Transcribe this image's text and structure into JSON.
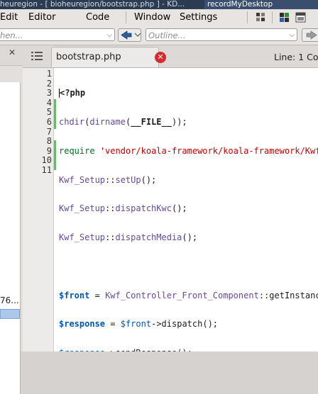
{
  "window": {
    "title_left": "heuregion - [ bioheuregion/bootstrap.php ] - KD...",
    "title_right": "recordMyDesktop"
  },
  "menubar": {
    "items": [
      "Edit",
      "Editor",
      "Code",
      "Window",
      "Settings"
    ]
  },
  "toolbar": {
    "search_value": "hen...",
    "outline_placeholder": "Outline..."
  },
  "left_panel": {
    "close_glyph": "✕",
    "truncated_item": "76..."
  },
  "tab": {
    "label": "bootstrap.php",
    "close_glyph": "✕"
  },
  "status": {
    "line_info": "Line: 1 Co"
  },
  "editor": {
    "line_numbers": [
      "1",
      "2",
      "3",
      "4",
      "5",
      "6",
      "7",
      "8",
      "9",
      "10",
      "11"
    ]
  },
  "colors": {
    "titlebar": "#2b3b52",
    "tab_close": "#d72a2a",
    "string": "#bf0303",
    "function": "#644a9b",
    "variable": "#0057ae",
    "change_marker": "#6bb86b"
  },
  "icons": [
    "nav-back-icon",
    "nav-forward-icon",
    "document-list-icon",
    "close-tab-icon",
    "panel-close-icon",
    "toolbar-config-icon",
    "toolbar-grid-icon"
  ]
}
